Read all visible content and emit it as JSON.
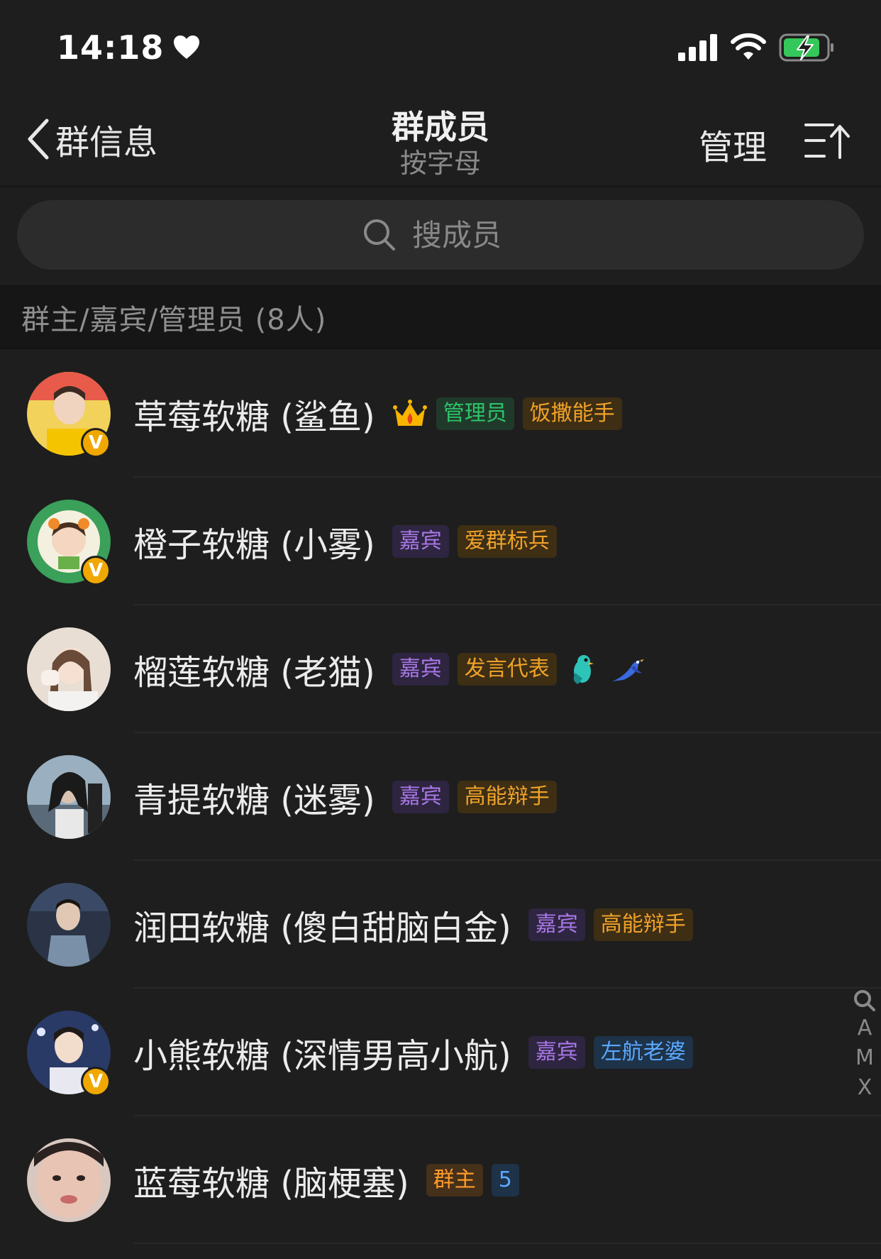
{
  "status_bar": {
    "time": "14:18",
    "icons": [
      "heart-icon",
      "signal-icon",
      "wifi-icon",
      "battery-charging-icon"
    ]
  },
  "nav": {
    "back_label": "群信息",
    "title": "群成员",
    "subtitle": "按字母",
    "manage_label": "管理",
    "sort_icon": "sort-ascending-icon"
  },
  "search": {
    "placeholder": "搜成员"
  },
  "section": {
    "label": "群主/嘉宾/管理员 (8人)"
  },
  "colors": {
    "background": "#1e1e1e",
    "admin_tag": "#2ec46a",
    "guest_tag": "#a877e6",
    "gold_tag": "#f0a22a",
    "blue_tag": "#5aa8ff",
    "verified_badge": "#f0a800"
  },
  "members": [
    {
      "name": "草莓软糖 (鲨鱼)",
      "verified_badge": "V",
      "crown_icon": "crown-icon",
      "tags": [
        "管理员",
        "饭撒能手"
      ]
    },
    {
      "name": "橙子软糖 (小雾)",
      "verified_badge": "V",
      "tags": [
        "嘉宾",
        "爱群标兵"
      ]
    },
    {
      "name": "榴莲软糖 (老猫)",
      "tags": [
        "嘉宾",
        "发言代表"
      ],
      "emoji_icons": [
        "bird-icon",
        "swallow-icon"
      ]
    },
    {
      "name": "青提软糖 (迷雾)",
      "tags": [
        "嘉宾",
        "高能辩手"
      ]
    },
    {
      "name": "润田软糖 (傻白甜脑白金)",
      "tags": [
        "嘉宾",
        "高能辩手"
      ]
    },
    {
      "name": "小熊软糖 (深情男高小航)",
      "verified_badge": "V",
      "tags": [
        "嘉宾",
        "左航老婆"
      ]
    },
    {
      "name": "蓝莓软糖 (脑梗塞)",
      "tags": [
        "群主",
        "5"
      ]
    }
  ],
  "index_bar": {
    "search_icon": "search-icon",
    "letters": [
      "A",
      "M",
      "X"
    ]
  }
}
